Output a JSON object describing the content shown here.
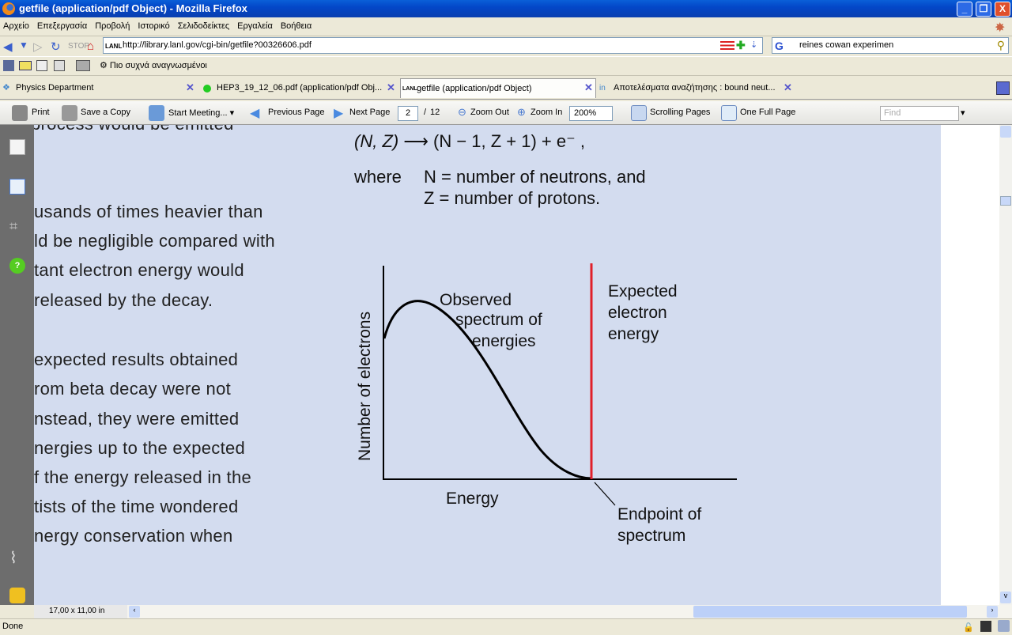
{
  "window": {
    "title": "getfile (application/pdf Object) - Mozilla Firefox",
    "minimize": "_",
    "restore": "❐",
    "close": "X"
  },
  "menu": [
    "Αρχείο",
    "Επεξεργασία",
    "Προβολή",
    "Ιστορικό",
    "Σελιδοδείκτες",
    "Εργαλεία",
    "Βοήθεια"
  ],
  "nav": {
    "url": "http://library.lanl.gov/cgi-bin/getfile?00326606.pdf",
    "search_value": "reines cowan experimen"
  },
  "bookmarks": {
    "most_visited": "Πιο συχνά αναγνωσμένοι"
  },
  "tabs": [
    {
      "label": "Physics Department",
      "active": false
    },
    {
      "label": "HEP3_19_12_06.pdf (application/pdf Obj...",
      "active": false
    },
    {
      "label": "getfile (application/pdf Object)",
      "active": true
    },
    {
      "label": "Αποτελέσματα αναζήτησης : bound neut...",
      "active": false
    }
  ],
  "pdf_toolbar": {
    "print": "Print",
    "save": "Save a Copy",
    "meeting": "Start Meeting...",
    "prev": "Previous Page",
    "next": "Next Page",
    "page": "2",
    "page_sep": "/",
    "total": "12",
    "zoom_out": "Zoom Out",
    "zoom_in": "Zoom In",
    "zoom": "200%",
    "scrolling": "Scrolling Pages",
    "full_page": "One Full Page",
    "find_placeholder": "Find"
  },
  "document": {
    "left_lines": [
      "process would be emitted",
      "",
      "usands of times heavier than",
      "ld be negligible compared with",
      "tant electron energy would",
      "released by the decay.",
      "",
      "expected results obtained",
      "rom beta decay were not",
      "nstead, they were emitted",
      "nergies up to the expected",
      "f the energy released in the",
      "tists of the time wondered",
      "nergy conservation when"
    ],
    "equation": {
      "lhs": "(N, Z)",
      "arrow": "⟶",
      "rhs": "(N − 1, Z + 1) + e⁻ ,"
    },
    "where": "where",
    "def_n": "N = number of neutrons, and",
    "def_z": "Z = number of protons.",
    "figure": {
      "ylabel": "Number of electrons",
      "xlabel": "Energy",
      "observed": [
        "Observed",
        "spectrum of",
        "energies"
      ],
      "expected": [
        "Expected",
        "electron",
        "energy"
      ],
      "endpoint": [
        "Endpoint of",
        "spectrum"
      ],
      "curve_color": "#000000",
      "expected_line_color": "#e0202a"
    }
  },
  "status": {
    "page_size": "17,00 x 11,00 in",
    "text": "Done"
  }
}
